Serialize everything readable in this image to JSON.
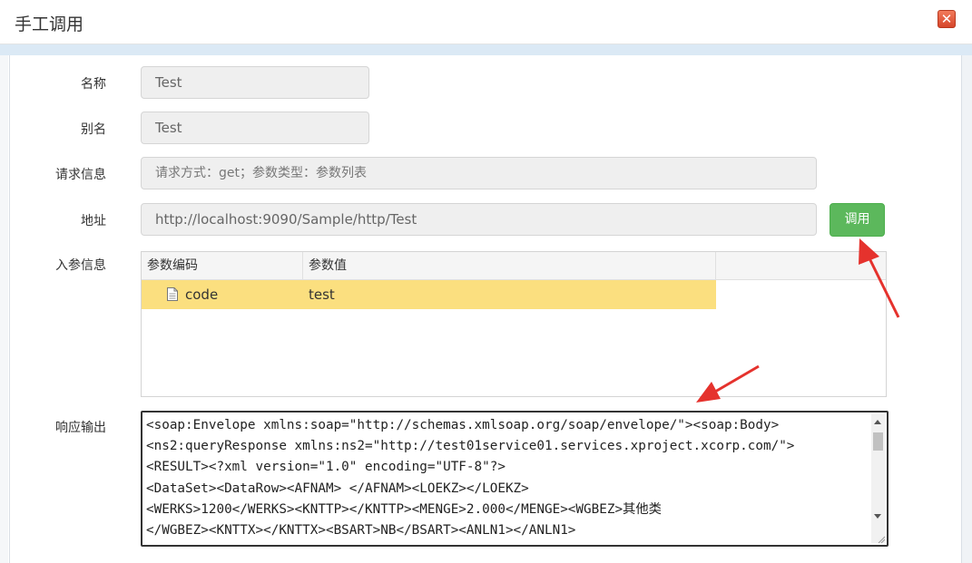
{
  "dialog": {
    "title": "手工调用",
    "close_symbol": "✕"
  },
  "form": {
    "name": {
      "label": "名称",
      "value": "Test"
    },
    "alias": {
      "label": "别名",
      "value": "Test"
    },
    "request_info": {
      "label": "请求信息",
      "placeholder": "请求方式：get；参数类型：参数列表"
    },
    "address": {
      "label": "地址",
      "value": "http://localhost:9090/Sample/http/Test"
    },
    "call_button": "调用",
    "params": {
      "label": "入参信息",
      "columns": [
        "参数编码",
        "参数值"
      ],
      "rows": [
        {
          "code": "code",
          "value": "test"
        }
      ]
    },
    "response": {
      "label": "响应输出",
      "lines": [
        "<soap:Envelope xmlns:soap=\"http://schemas.xmlsoap.org/soap/envelope/\"><soap:Body>",
        "<ns2:queryResponse xmlns:ns2=\"http://test01service01.services.xproject.xcorp.com/\">",
        "<RESULT><?xml version=\"1.0\" encoding=\"UTF-8\"?>",
        "<DataSet><DataRow><AFNAM>               </AFNAM><LOEKZ></LOEKZ>",
        "<WERKS>1200</WERKS><KNTTP></KNTTP><MENGE>2.000</MENGE><WGBEZ>其他类",
        "</WGBEZ><KNTTX></KNTTX><BSART>NB</BSART><ANLN1></ANLN1>"
      ]
    }
  },
  "colors": {
    "call_button": "#5cb85c",
    "selected_row": "#fbdf7f",
    "annotation_arrow": "#e5322d",
    "close_button": "#e0502f"
  }
}
